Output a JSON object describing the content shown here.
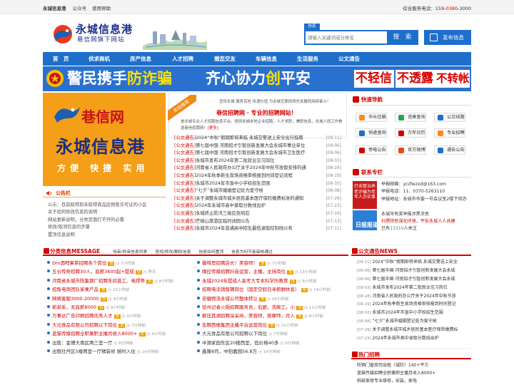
{
  "topbar": {
    "site_name": "永城信息港",
    "wechat": "公众号",
    "help": "使用帮助",
    "service_prefix": "综合服务电话：159-",
    "service_red": "0380",
    "service_suffix": "-3000"
  },
  "logo": {
    "title": "永城信息港",
    "subtitle": "巷信网旗下网站"
  },
  "search": {
    "tab": "信息",
    "placeholder": "请输入关键词或分类名",
    "button": "搜 索",
    "post": "发布信息"
  },
  "nav": [
    "首　页",
    "供求商机",
    "房产信息",
    "人才招聘",
    "婚恋交友",
    "车辆信息",
    "生活服务",
    "公文通告"
  ],
  "banner": {
    "s1a": "警民携手",
    "s1b": "防诈骗",
    "s2a": "齐心协力",
    "s2b": "创",
    "s2c": "平安",
    "s3": "不轻信",
    "s4": "不透露",
    "s5": "不转帐"
  },
  "left_ad": {
    "line1": "巷信网",
    "line2": "永城信息港",
    "line3": "方便 快捷 实用"
  },
  "notice": {
    "title": "公告栏",
    "items": [
      "公示：目前取得和未取得商品房预售许可证的小区",
      "关于如何修改信息的说明",
      "网站更新说明，分类页面打不开的必看",
      "修改/取消信息的步骤",
      "置顶信息说明"
    ]
  },
  "mid": {
    "ribbon": "本站推荐",
    "small": "宣传永城 服务百姓 传递价值 为永城互联网领先发展而持续奋斗！",
    "headline": "巷信招聘网 · 专业的招聘网站！",
    "para_a": "是永城专业人才招聘信息平台，提供永城本地企业招聘，人才求职，兼职信息，永城人找工作首选巷信招聘网！",
    "para_link": "[更多]",
    "news": [
      {
        "tag": "[公文通告]",
        "title": "2024“中秋”假期即将来临 永城交警送上安全出行指南",
        "date": "[09-11]"
      },
      {
        "tag": "[公文通告]",
        "title": "第七届中国·河南招才引智创新发展大会永城市事业单位",
        "date": "[09-06]"
      },
      {
        "tag": "[公文通告]",
        "title": "第七届中国·河南招才引智创新发展大会永城市卫生医疗",
        "date": "[09-06]"
      },
      {
        "tag": "[公文通告]",
        "title": "永城市发布2024年第二批就业见习岗位",
        "date": "[09-03]"
      },
      {
        "tag": "[公文通告]",
        "title": "河南省人民政府办公厅关于2024年中秋节放假安排的通",
        "date": "[08-28]"
      },
      {
        "tag": "[公文通告]",
        "title": "2024年秋季新生现场资格审核报到时间登记流程",
        "date": "[08-19]"
      },
      {
        "tag": "[公文通告]",
        "title": "永城市2024年市直中小学校招生范围",
        "date": "[08-10]"
      },
      {
        "tag": "[公文通告]",
        "title": "“七夕”永城市婚姻登记处为爱守候",
        "date": "[08-08]"
      },
      {
        "tag": "[公文通告]",
        "title": "关于调整永城市城乡居民基本医疗保险缴费标准的通知",
        "date": "[07-29]"
      },
      {
        "tag": "[公文通告]",
        "title": "2024年永城市高中录取分数线出炉",
        "date": "[07-23]"
      },
      {
        "tag": "[公文通告]",
        "title": "永城终止防汛三级应急响应",
        "date": "[07-19]"
      },
      {
        "tag": "[公文通告]",
        "title": "芒砀山旅游区临时闭园公告",
        "date": "[07-13]"
      },
      {
        "tag": "[公文通告]",
        "title": "永城市2024年普通高中招生最低录取控制线公布",
        "date": "[07-11]"
      }
    ]
  },
  "quick": {
    "title": "快速导航",
    "items": [
      "市长信箱",
      "违章查询",
      "公交线路",
      "快递查询",
      "万年日历",
      "专业招聘",
      "停电公告",
      "官方微博",
      "通告公告"
    ]
  },
  "zhuanxian": {
    "title": "联系专栏",
    "ad": "打击整治养老诈骗为老年人办实事",
    "email": "举报邮箱：yczfwzxd@163.com",
    "phone": "举报电话：11、0370-5263110",
    "addr": "举报地址：永城市市委一号会议室2楼下岗办",
    "pic": "日报报道",
    "t1": "永城市有奖举报涉黑涉恶",
    "t2": "扫黑除恶谋化环境，平安永城人人共建",
    "t3_pre": "已有",
    "t3_num": "13310",
    "t3_suf": "人关注"
  },
  "cls_head": {
    "title": "分类信息MESSAGE",
    "links": [
      "待审/非审信息列表",
      "查找/修改/删除信息",
      "信息如何置顶",
      "信息为何不能审核通过"
    ]
  },
  "cls_left": [
    {
      "t": "Dm酒吧果茶招聘各个岗位",
      "red": true,
      "tm": "7小时前",
      "hot": true
    },
    {
      "t": "五谷传奇招聘30人，底薪3600起+提成",
      "red": true,
      "tm": "昨天",
      "hot": true
    },
    {
      "t": "河南省永城市陈集钢厂招聘车间普工、电焊等",
      "red": true,
      "tm": "8小时前",
      "hot": true
    },
    {
      "t": "招售电商团队家禽产品",
      "red": true,
      "tm": "22小时前",
      "hot": true
    },
    {
      "t": "网络客服3000-20000",
      "red": true,
      "tm": "9小时前",
      "hot": true
    },
    {
      "t": "新单系，无底薪8000",
      "red": true,
      "tm": "9小时前",
      "hot": true
    },
    {
      "t": "万事达广告印刷招聘优秀人才",
      "red": true,
      "tm": "4小时前",
      "hot": true
    },
    {
      "t": "大元食品有限公司招聘以下岗位",
      "red": true,
      "tm": "7分钟前",
      "hot": true
    },
    {
      "t": "蓝猫传媒招聘全职兼职主播月收入8000+",
      "red": true,
      "tm": "4小时前",
      "hot": true
    },
    {
      "t": "出售：金博大南区两三室一厅",
      "red": false,
      "tm": "8分钟前",
      "hot": false
    },
    {
      "t": "出租社丹区5楼两室一厅精装修 随时入住",
      "red": false,
      "tm": "14分钟前",
      "hot": false
    }
  ],
  "cls_right": [
    {
      "t": "馨特思招聘店长！美容师！",
      "red": true,
      "tm": "7小时前",
      "hot": true
    },
    {
      "t": "隆控传媒招聘抖音运营，主播，主持岗位",
      "red": true,
      "tm": "13小时前",
      "hot": true
    },
    {
      "t": "永城2024年提成人高考大专本科学历教育",
      "red": true,
      "tm": "6小时前",
      "hot": true
    },
    {
      "t": "招聘电话销售聘岗位（固定空假日寻薪酬休息）",
      "red": true,
      "tm": "14小时前",
      "hot": true
    },
    {
      "t": "安徽物流永城公司整体转让",
      "red": true,
      "tm": "14小时前",
      "hot": true
    },
    {
      "t": "徐州记者火锅招聘服务员，后厨，洗碗工，小",
      "red": true,
      "tm": "11小时前",
      "hot": true
    },
    {
      "t": "解压其湖招聘深采持，美容师，按摩师，月入",
      "red": true,
      "tm": "8小时前",
      "hot": true
    },
    {
      "t": "急聘西楼集团主播平台运营岗位",
      "red": true,
      "tm": "21小时前",
      "hot": true
    },
    {
      "t": "大元食品有限公司招聘以下岗位",
      "red": false,
      "tm": "7分钟前",
      "hot": false
    },
    {
      "t": "中源家园东区20楼西室，低价格40多",
      "red": false,
      "tm": "9分钟前",
      "hot": false
    },
    {
      "t": "鑫隆8月，中阳嘉园56.8万",
      "red": false,
      "tm": "14分钟前",
      "hot": false
    }
  ],
  "wnews": {
    "title": "公文通告NEWS",
    "items": [
      {
        "d": "[09-11]",
        "t": "2024“中秋”假期即将来临 永城交警送上安全"
      },
      {
        "d": "[09-06]",
        "t": "第七届中国·河南招才引智创新发展大会永城"
      },
      {
        "d": "[09-06]",
        "t": "第七届中国·河南招才引智创新发展大会永城"
      },
      {
        "d": "[09-03]",
        "t": "永城市发布2024年第二批就业见习岗位"
      },
      {
        "d": "[08-28]",
        "t": "河南省人民政府办公厅关于2024年中秋节放"
      },
      {
        "d": "[08-19]",
        "t": "2024年秋季新生现场资格审核报到时间登记"
      },
      {
        "d": "[08-10]",
        "t": "永城市2024年市直中小学校招生范围"
      },
      {
        "d": "[08-08]",
        "t": "“七夕”永城市婚姻登记处为爱守候"
      },
      {
        "d": "[07-29]",
        "t": "关于调整永城市城乡居民基本医疗保险缴费标"
      },
      {
        "d": "[07-23]",
        "t": "2024年永城市高中录取分数线出炉"
      }
    ]
  },
  "hot": {
    "title": "热门招聘",
    "items": [
      "旺辆门窗商司出租（城防）140+平方",
      "蓝猫传媒招聘全职兼职主播月收入8000+",
      "蚂蚁家修专业维修，安装，家电"
    ]
  },
  "colors": {
    "accent": "#1e6fcc",
    "red": "#d60000",
    "orange": "#f59e18"
  }
}
